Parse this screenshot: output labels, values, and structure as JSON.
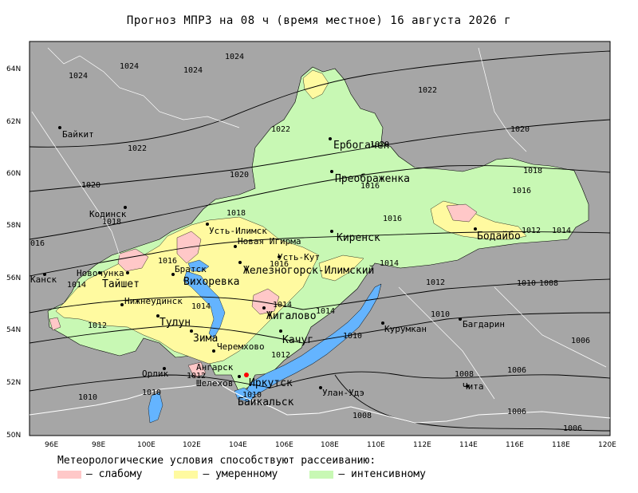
{
  "title": "Прогноз МПРЗ на 08 ч (время местное) 16 августа 2026 г",
  "colors": {
    "background": "#a6a6a6",
    "weak": "#ffc8c8",
    "moderate": "#fffaa0",
    "intensive": "#c8f8b4",
    "water": "#64b4ff"
  },
  "lat_labels": [
    "64N",
    "62N",
    "60N",
    "58N",
    "56N",
    "54N",
    "52N",
    "50N"
  ],
  "lon_labels": [
    "96E",
    "98E",
    "100E",
    "102E",
    "104E",
    "106E",
    "108E",
    "110E",
    "112E",
    "114E",
    "116E",
    "118E",
    "120E"
  ],
  "cities": {
    "baikit": "Байкит",
    "erbogachen": "Ербогачен",
    "preobrazhenka": "Преображенка",
    "kodinsk": "Кодинск",
    "ust_ilimsk": "Усть-Илимск",
    "kirensk": "Киренск",
    "bodaibo": "Бодайбо",
    "novaya_igirma": "Новая Игирма",
    "ust_kut": "Усть-Кут",
    "zheleznogorsk": "Железногорск-Илимский",
    "bratsk": "Братск",
    "vikhorevka": "Вихоревка",
    "novochunka": "Новочунка",
    "kansk": "Канск",
    "tayshet": "Тайшет",
    "nizhneudinsk": "Нижнеудинск",
    "tulun": "Тулун",
    "zhigalovo": "Жигалово",
    "kachug": "Качуг",
    "kurumkan": "Курумкан",
    "bagdarin": "Багдарин",
    "zima": "Зима",
    "cheremkhovo": "Черемхово",
    "angarsk": "Ангарск",
    "shelekhov": "Шелехов",
    "irkutsk": "Иркутск",
    "baykalsk": "Байкальск",
    "ulan_ude": "Улан-Удэ",
    "chita": "Чита",
    "orlik": "Орлик"
  },
  "isobars": [
    "1024",
    "1024",
    "1024",
    "1024",
    "1022",
    "1022",
    "1022",
    "1020",
    "1020",
    "1020",
    "1018",
    "1016",
    "1018",
    "1016",
    "1016",
    "1014",
    "1012",
    "1014",
    "1012",
    "1010",
    "1008",
    "1006",
    "1008",
    "1006",
    "1006",
    "1008"
  ],
  "iso": {
    "a": "1024",
    "b": "1024",
    "c": "1024",
    "d": "1024",
    "e": "1022",
    "f": "1022",
    "g": "1022",
    "h": "1020",
    "i": "1020",
    "j": "1020",
    "k": "1020",
    "l": "1018",
    "m": "1018",
    "n": "1018",
    "o": "1016",
    "p": "1016",
    "q": "1016",
    "r": "1016",
    "s": "1016",
    "t": "1016",
    "u": "016",
    "v": "1014",
    "w": "1014",
    "x": "1014",
    "y": "1014",
    "z": "1014",
    "aa": "1012",
    "ab": "1012",
    "ac": "1012",
    "ad": "1012",
    "ae": "1012",
    "af": "1010",
    "ag": "1010",
    "ah": "1010",
    "ai": "1010",
    "aj": "1010",
    "ak": "1010",
    "al": "1008",
    "am": "1008",
    "an": "1008",
    "ao": "1008",
    "ap": "1006",
    "aq": "1006",
    "ar": "1006",
    "as": "1006",
    "at": "1016",
    "au": "1014",
    "av": "1012",
    "aw": "1010",
    "ax": "1014"
  },
  "legend": {
    "caption": "Метеорологические условия способствуют рассеиванию:",
    "weak": "– слабому",
    "moderate": "– умеренному",
    "intensive": "– интенсивному"
  }
}
